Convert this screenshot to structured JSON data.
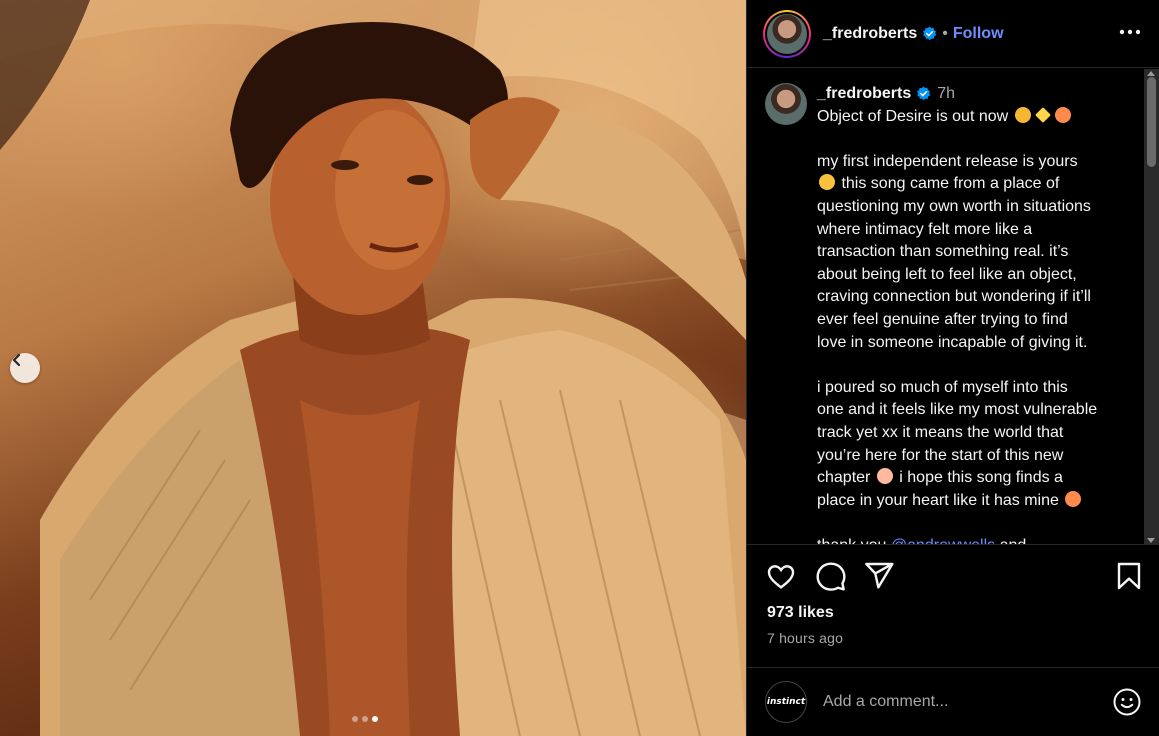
{
  "post": {
    "username": "_fredroberts",
    "verified": true,
    "follow_label": "Follow",
    "separator": "•",
    "caption_time": "7h",
    "caption_lines": [
      "Object of Desire is out now",
      "",
      "my first independent release is yours",
      "this song came from a place of",
      "questioning my own worth in situations",
      "where intimacy felt more like a",
      "transaction than something real. it’s",
      "about being left to feel like an object,",
      "craving connection but wondering if it’ll",
      "ever feel genuine after trying to find",
      "love in someone incapable of giving it.",
      "",
      "i poured so much of myself into this",
      "one and it feels like my most vulnerable",
      "track yet xx it means the world that",
      "you’re here for the start of this new",
      "chapter",
      "i hope this song finds a",
      "place in your heart like it has mine",
      "",
      "thank you",
      "@andrewwells",
      "and"
    ],
    "likes": "973 likes",
    "time_ago": "7 hours ago"
  },
  "carousel": {
    "total": 3,
    "active_index": 2
  },
  "comment": {
    "placeholder": "Add a comment...",
    "commenter_avatar_text": "instinct"
  },
  "icons": {
    "like": "heart-icon",
    "comment": "speech-bubble-icon",
    "share": "paper-plane-icon",
    "save": "bookmark-icon",
    "more": "ellipsis-icon",
    "prev": "chevron-left-icon",
    "emoji": "smiley-icon",
    "verified": "verified-badge-icon"
  },
  "colors": {
    "accent": "#0095f6",
    "link": "#708dff",
    "verified": "#0095f6"
  }
}
